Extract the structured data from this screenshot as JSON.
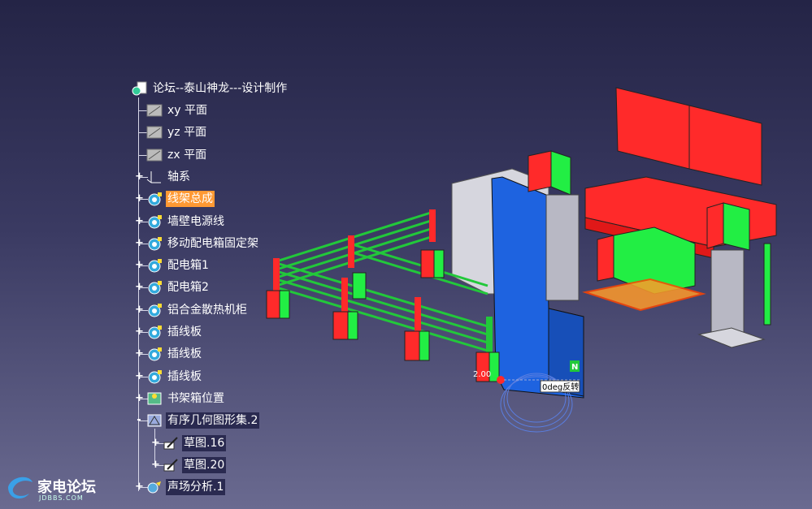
{
  "tree": {
    "root": {
      "label": "论坛--泰山神龙---设计制作",
      "icon": "part-document-icon"
    },
    "items": [
      {
        "label": "xy 平面",
        "icon": "plane-icon",
        "expander": ""
      },
      {
        "label": "yz 平面",
        "icon": "plane-icon",
        "expander": ""
      },
      {
        "label": "zx 平面",
        "icon": "plane-icon",
        "expander": ""
      },
      {
        "label": "轴系",
        "icon": "axis-system-icon",
        "expander": "+"
      },
      {
        "label": "线架总成",
        "icon": "assembly-gear-icon",
        "expander": "+",
        "selected": true
      },
      {
        "label": "墙壁电源线",
        "icon": "assembly-gear-icon",
        "expander": "+"
      },
      {
        "label": "移动配电箱固定架",
        "icon": "assembly-gear-icon",
        "expander": "+"
      },
      {
        "label": "配电箱1",
        "icon": "assembly-gear-icon",
        "expander": "+"
      },
      {
        "label": "配电箱2",
        "icon": "assembly-gear-icon",
        "expander": "+"
      },
      {
        "label": "铝合金散热机柜",
        "icon": "assembly-gear-icon",
        "expander": "+"
      },
      {
        "label": "插线板",
        "icon": "assembly-gear-icon",
        "expander": "+"
      },
      {
        "label": "插线板",
        "icon": "assembly-gear-icon",
        "expander": "+"
      },
      {
        "label": "插线板",
        "icon": "assembly-gear-icon",
        "expander": "+"
      },
      {
        "label": "书架箱位置",
        "icon": "bookshelf-icon",
        "expander": "+"
      },
      {
        "label": "有序几何图形集.2",
        "icon": "geometric-set-icon",
        "expander": "-"
      },
      {
        "label": "草图.16",
        "icon": "sketch-icon",
        "expander": "+",
        "indent": 1
      },
      {
        "label": "草图.20",
        "icon": "sketch-icon",
        "expander": "+",
        "indent": 1
      },
      {
        "label": "声场分析.1",
        "icon": "acoustic-analysis-icon",
        "expander": "+"
      }
    ]
  },
  "viewport": {
    "dimension_label": "2.00",
    "compass_label": "N",
    "angle_label": "0deg反转",
    "colors": {
      "red": "#ff2a2a",
      "green": "#22ee44",
      "blue": "#1a5fd6",
      "gray": "#c8c8d0"
    }
  },
  "logo": {
    "text": "家电论坛",
    "subtext": "JDBBS.COM"
  }
}
